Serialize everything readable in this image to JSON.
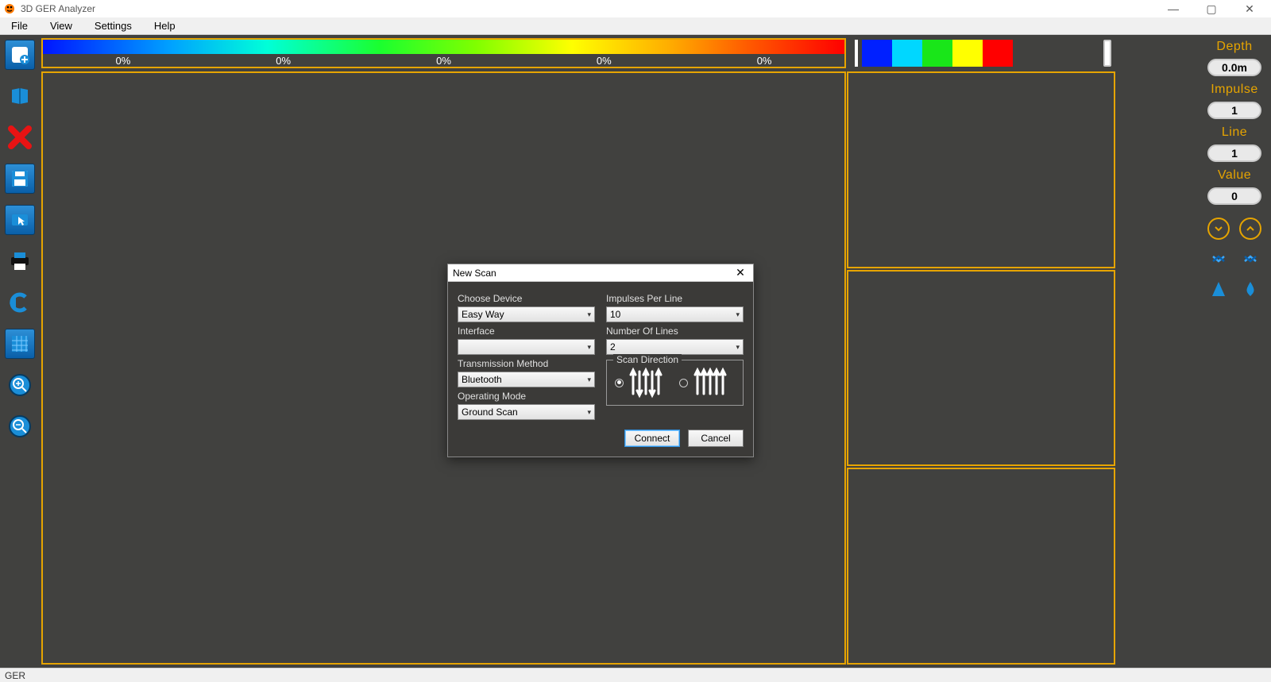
{
  "window": {
    "title": "3D GER Analyzer"
  },
  "menus": {
    "file": "File",
    "view": "View",
    "settings": "Settings",
    "help": "Help"
  },
  "gradient_ticks": [
    "0%",
    "0%",
    "0%",
    "0%",
    "0%"
  ],
  "mini_colors": [
    "#0020ff",
    "#00d7ff",
    "#19e619",
    "#ffff00",
    "#ff0000"
  ],
  "right": {
    "depth_label": "Depth",
    "depth_value": "0.0m",
    "impulse_label": "Impulse",
    "impulse_value": "1",
    "line_label": "Line",
    "line_value": "1",
    "value_label": "Value",
    "value_value": "0"
  },
  "dialog": {
    "title": "New Scan",
    "choose_device_label": "Choose Device",
    "choose_device_value": "Easy Way",
    "interface_label": "Interface",
    "interface_value": "",
    "transmission_label": "Transmission Method",
    "transmission_value": "Bluetooth",
    "operating_label": "Operating Mode",
    "operating_value": "Ground Scan",
    "impulses_label": "Impulses Per Line",
    "impulses_value": "10",
    "lines_label": "Number Of Lines",
    "lines_value": "2",
    "scan_dir_label": "Scan Direction",
    "connect": "Connect",
    "cancel": "Cancel"
  },
  "status": {
    "text": "GER"
  }
}
